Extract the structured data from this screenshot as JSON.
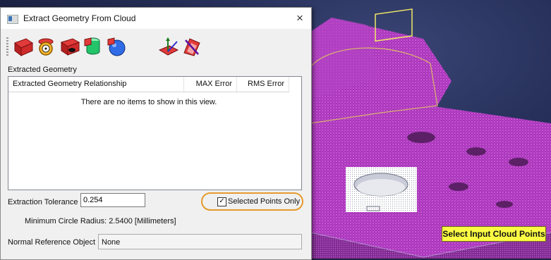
{
  "dialog": {
    "title": "Extract Geometry From Cloud",
    "close_glyph": "×",
    "toolbar": [
      {
        "icon": "plane-extract-icon"
      },
      {
        "icon": "circle-extract-icon"
      },
      {
        "icon": "slot-extract-icon"
      },
      {
        "icon": "cylinder-extract-icon"
      },
      {
        "icon": "sphere-extract-icon"
      },
      {
        "icon": "axis-plane-icon"
      },
      {
        "icon": "clear-selection-icon"
      }
    ],
    "group_label": "Extracted Geometry",
    "list": {
      "columns": [
        "Extracted Geometry Relationship",
        "MAX Error",
        "RMS Error"
      ],
      "empty_text": "There are no items to show in this view."
    },
    "tolerance": {
      "label": "Extraction Tolerance",
      "value": "0.254"
    },
    "selected_points_only": {
      "label": "Selected Points Only",
      "checked": true
    },
    "min_radius_text": "Minimum Circle Radius: 2.5400 [Millimeters]",
    "normal_reference": {
      "label": "Normal Reference Object",
      "value": "None"
    }
  },
  "viewport": {
    "status_label": "Select Input Cloud Points",
    "point_cloud_color": "#d24dd6",
    "highlight_color": "#e69a2c"
  }
}
